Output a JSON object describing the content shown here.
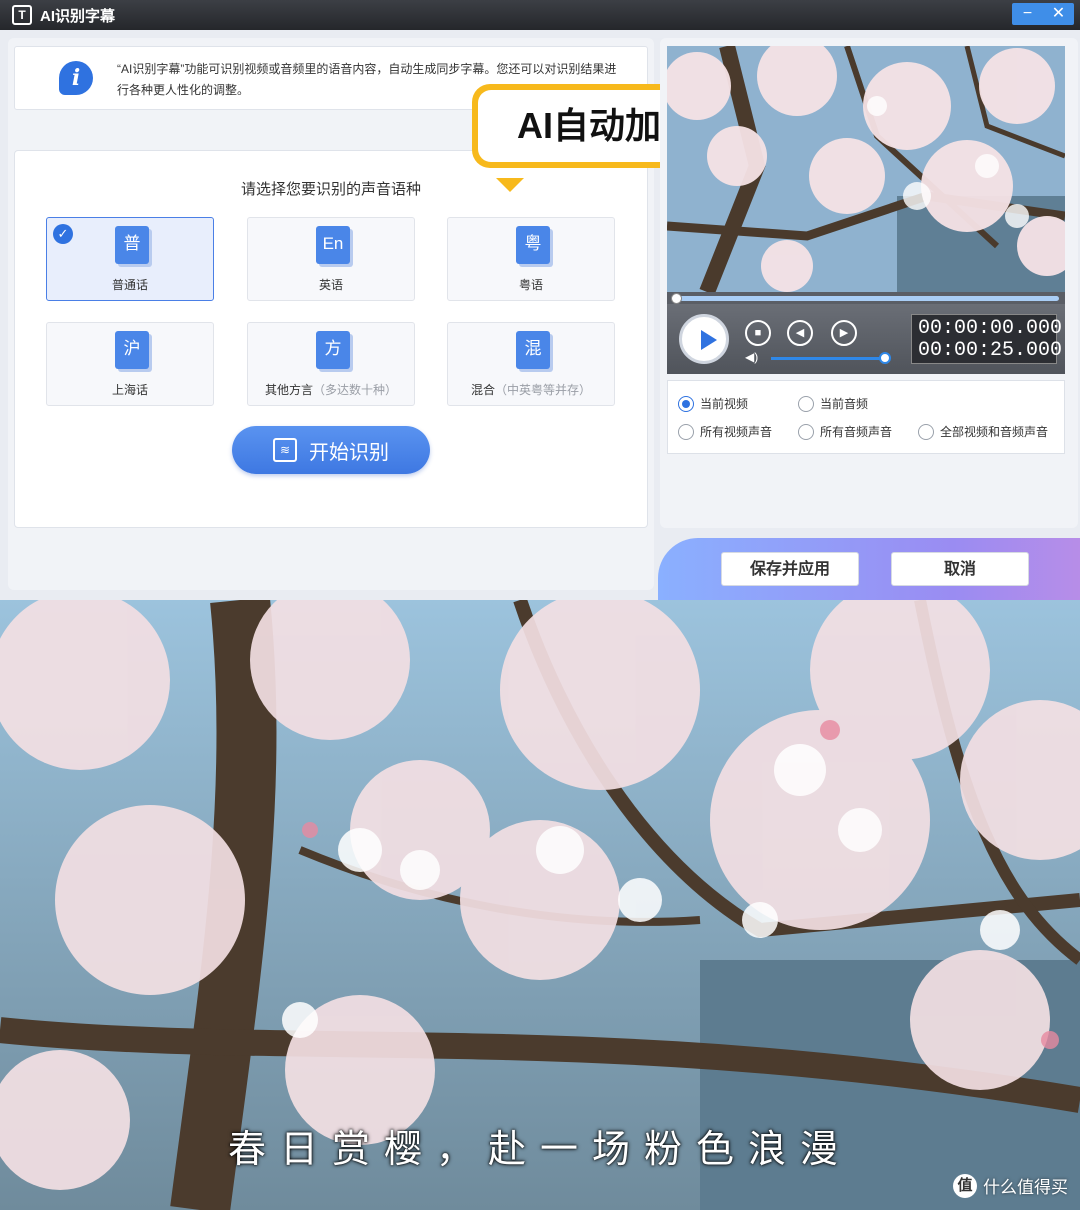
{
  "window": {
    "icon_glyph": "T",
    "title": "AI识别字幕",
    "minimize": "−",
    "close": "✕"
  },
  "info": {
    "icon_glyph": "i",
    "text": "“AI识别字幕”功能可识别视频或音频里的语音内容，自动生成同步字幕。您还可以对识别结果进行各种更人性化的调整。"
  },
  "overlay_tag": "AI自动加字幕",
  "language": {
    "heading": "请选择您要识别的声音语种",
    "selected_check": "✓",
    "options": [
      {
        "glyph": "普",
        "label": "普通话",
        "sub": ""
      },
      {
        "glyph": "En",
        "label": "英语",
        "sub": ""
      },
      {
        "glyph": "粤",
        "label": "粤语",
        "sub": ""
      },
      {
        "glyph": "沪",
        "label": "上海话",
        "sub": ""
      },
      {
        "glyph": "方",
        "label": "其他方言",
        "sub": "（多达数十种）"
      },
      {
        "glyph": "混",
        "label": "混合",
        "sub": "（中英粤等并存）"
      }
    ],
    "selected_index": 0
  },
  "start_button": {
    "icon_glyph": "≋",
    "label": "开始识别"
  },
  "player": {
    "progress": 0.0,
    "volume": 0.95,
    "current_time": "00:00:00.000",
    "total_time": "00:00:25.000",
    "collapse_glyph": "⌄",
    "controls": {
      "stop": "■",
      "prev": "◀",
      "next": "▶",
      "volume": "◀)"
    }
  },
  "source_options": [
    {
      "label": "当前视频",
      "checked": true
    },
    {
      "label": "当前音频",
      "checked": false
    },
    {
      "label": "所有视频声音",
      "checked": false
    },
    {
      "label": "所有音频声音",
      "checked": false
    },
    {
      "label": "全部视频和音频声音",
      "checked": false
    }
  ],
  "footer": {
    "save_label": "保存并应用",
    "cancel_label": "取消"
  },
  "photo": {
    "subtitle": "春日赏樱，赴一场粉色浪漫",
    "watermark_icon": "值",
    "watermark_text": "什么值得买"
  },
  "colors": {
    "accent": "#2f72e0",
    "tag_yellow": "#f7b91c",
    "blossom": "#f6e3e6",
    "sky": "#8fb2cf"
  }
}
